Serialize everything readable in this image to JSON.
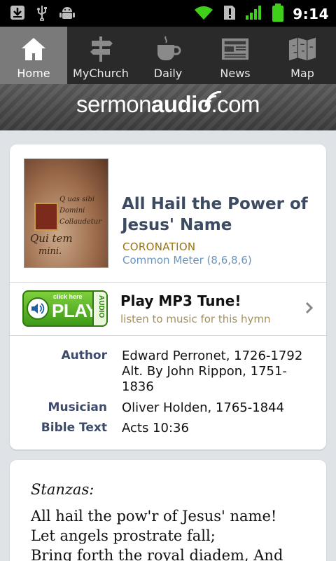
{
  "status_bar": {
    "time": "9:14",
    "icons": [
      "download-icon",
      "usb-icon",
      "android-debug-icon",
      "wifi-icon",
      "alert-icon",
      "signal-icon",
      "battery-icon"
    ]
  },
  "tabs": [
    {
      "label": "Home",
      "icon": "home-icon",
      "active": true
    },
    {
      "label": "MyChurch",
      "icon": "signpost-icon",
      "active": false
    },
    {
      "label": "Daily",
      "icon": "coffee-cup-icon",
      "active": false
    },
    {
      "label": "News",
      "icon": "newspaper-icon",
      "active": false
    },
    {
      "label": "Map",
      "icon": "map-icon",
      "active": false
    }
  ],
  "brand": {
    "light": "sermon",
    "bold": "audio",
    "suffix": ".com"
  },
  "hymn": {
    "title": "All Hail the Power of Jesus' Name",
    "tune": "CORONATION",
    "meter": "Common Meter (8,6,8,6)"
  },
  "play": {
    "button_click_here": "click here",
    "button_play": "PLAY",
    "button_audio": "AUDIO",
    "title": "Play MP3 Tune!",
    "subtitle": "listen to music for this hymn"
  },
  "info": {
    "author_label": "Author",
    "author_lines": [
      "Edward Perronet, 1726-1792",
      "Alt. By John Rippon, 1751-",
      "1836"
    ],
    "musician_label": "Musician",
    "musician": "Oliver Holden, 1765-1844",
    "bible_label": "Bible Text",
    "bible": "Acts 10:36"
  },
  "stanzas": {
    "heading": "Stanzas:",
    "lines": [
      "All hail the pow'r of Jesus' name!",
      "Let angels prostrate fall;",
      "Bring forth the royal diadem, And"
    ]
  },
  "colors": {
    "active_tab": "#7a7a7a",
    "title": "#3c4a62",
    "tune": "#9a7414",
    "meter": "#6a94c0",
    "play_green": "#3e9a17"
  }
}
